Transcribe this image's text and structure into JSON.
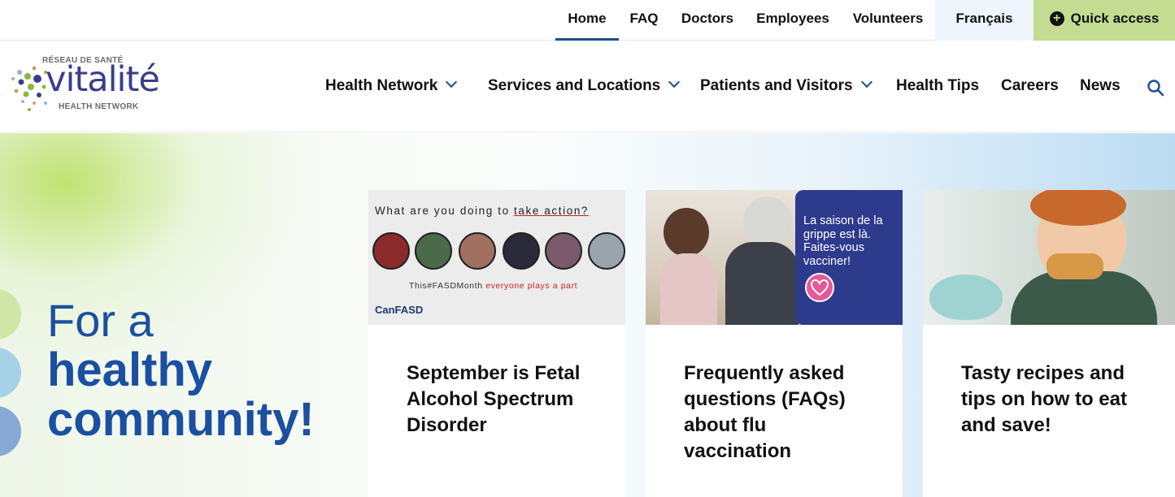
{
  "topbar": {
    "home": "Home",
    "faq": "FAQ",
    "doctors": "Doctors",
    "employees": "Employees",
    "volunteers": "Volunteers",
    "language": "Français",
    "quick_access": "Quick access"
  },
  "logo": {
    "small_text": "RÉSEAU DE SANTÉ",
    "main_text": "vitalité",
    "sub_text": "HEALTH NETWORK"
  },
  "nav": {
    "items": [
      {
        "label": "Health Network"
      },
      {
        "label": "Services and Locations"
      },
      {
        "label": "Patients and Visitors"
      },
      {
        "label": "Health Tips"
      },
      {
        "label": "Careers"
      },
      {
        "label": "News"
      }
    ]
  },
  "hero": {
    "line1": "For a",
    "line2": "healthy",
    "line3": "community!"
  },
  "cards": [
    {
      "image": {
        "question_prefix": "What are you doing to ",
        "question_emphasis": "take action?",
        "tag_prefix": "This#FASDMonth ",
        "tag_emphasis": "everyone plays a part",
        "logo": "CanFASD"
      },
      "title": "September is Fetal Alcohol Spectrum Disorder"
    },
    {
      "image": {
        "panel_text": "La saison de la grippe est là. Faites-vous vacciner!"
      },
      "title": "Frequently asked questions (FAQs) about flu vaccination"
    },
    {
      "title": "Tasty recipes and tips on how to eat and save!"
    }
  ]
}
